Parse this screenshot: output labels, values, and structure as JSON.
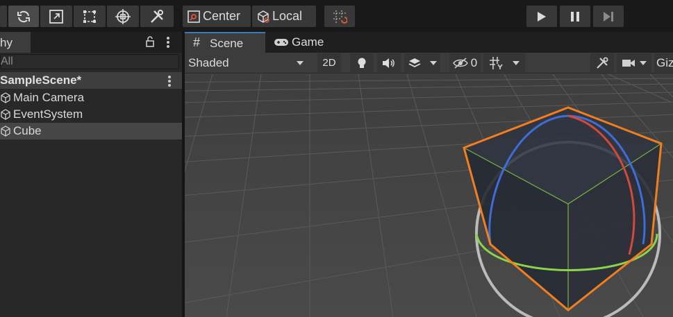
{
  "toolbar": {
    "pivot_label": "Center",
    "space_label": "Local",
    "tools": [
      "rotate-tool",
      "scale-tool",
      "rect-tool",
      "transform-tool",
      "custom-tool"
    ],
    "play_controls": [
      "play",
      "pause",
      "step"
    ]
  },
  "hierarchy": {
    "tab_label": "hy",
    "search_placeholder": "All",
    "scene_name": "SampleScene*",
    "items": [
      {
        "label": "Main Camera"
      },
      {
        "label": "EventSystem"
      },
      {
        "label": "Cube",
        "selected": true
      }
    ]
  },
  "scene_view": {
    "tabs": [
      {
        "label": "Scene",
        "active": true
      },
      {
        "label": "Game",
        "active": false
      }
    ],
    "shading_mode": "Shaded",
    "mode_2d_label": "2D",
    "hidden_count": "0",
    "gizmos_label": "Giz"
  },
  "colors": {
    "accent_blue": "#3a79bb",
    "selection_orange": "#f27e1e",
    "axis_x": "#d24a3a",
    "axis_y": "#8ad44a",
    "axis_z": "#3d6ed8"
  }
}
